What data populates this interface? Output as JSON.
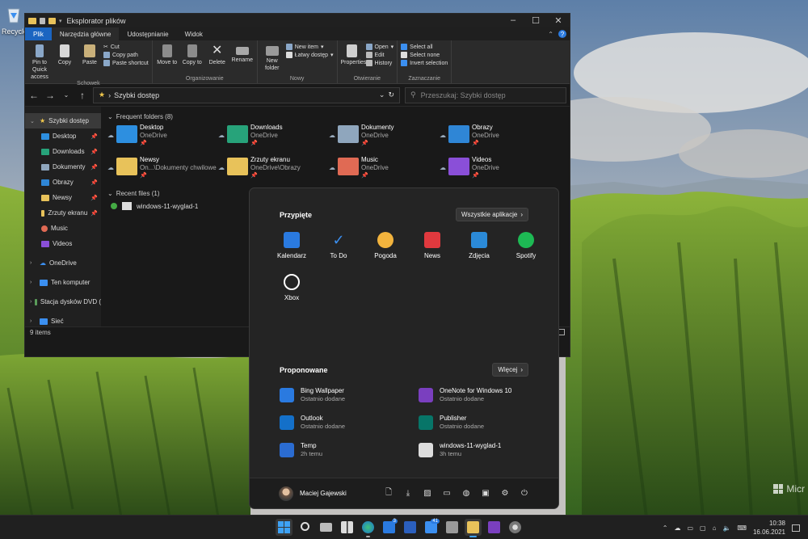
{
  "desktop": {
    "recycle_bin_label": "Recycle"
  },
  "watermark": "Micr",
  "explorer": {
    "title": "Eksplorator plików",
    "window_buttons": [
      "–",
      "☐",
      "✕"
    ],
    "tabs": [
      "Plik",
      "Narzędzia główne",
      "Udostępnianie",
      "Widok"
    ],
    "ribbon": {
      "clipboard": {
        "name": "Schowek",
        "pin": "Pin to Quick access",
        "copy": "Copy",
        "paste": "Paste",
        "cut": "Cut",
        "copy_path": "Copy path",
        "paste_shortcut": "Paste shortcut"
      },
      "organize": {
        "name": "Organizowanie",
        "move_to": "Move to",
        "copy_to": "Copy to",
        "delete": "Delete",
        "rename": "Rename"
      },
      "new": {
        "name": "Nowy",
        "new_folder": "New folder",
        "new_item": "New item",
        "easy_access": "Łatwy dostęp"
      },
      "open": {
        "name": "Otwieranie",
        "properties": "Properties",
        "open": "Open",
        "edit": "Edit",
        "history": "History"
      },
      "select": {
        "name": "Zaznaczanie",
        "select_all": "Select all",
        "select_none": "Select none",
        "invert": "Invert selection"
      }
    },
    "address": "Szybki dostęp",
    "search_placeholder": "Przeszukaj: Szybki dostęp",
    "nav": {
      "quick_access": "Szybki dostęp",
      "items": [
        "Desktop",
        "Downloads",
        "Dokumenty",
        "Obrazy",
        "Newsy",
        "Zrzuty ekranu",
        "Music",
        "Videos"
      ],
      "onedrive": "OneDrive",
      "this_pc": "Ten komputer",
      "dvd": "Stacja dysków DVD (",
      "network": "Sieć"
    },
    "frequent_header": "Frequent folders (8)",
    "folders": [
      {
        "name": "Desktop",
        "loc": "OneDrive",
        "color": "#2d8fe0"
      },
      {
        "name": "Downloads",
        "loc": "OneDrive",
        "color": "#27a37a"
      },
      {
        "name": "Dokumenty",
        "loc": "OneDrive",
        "color": "#8fa6bd"
      },
      {
        "name": "Obrazy",
        "loc": "OneDrive",
        "color": "#2f86d6"
      },
      {
        "name": "Newsy",
        "loc": "On...\\Dokumenty chwilowe",
        "color": "#e8c25a"
      },
      {
        "name": "Zrzuty ekranu",
        "loc": "OneDrive\\Obrazy",
        "color": "#e8c25a"
      },
      {
        "name": "Music",
        "loc": "OneDrive",
        "color": "#e06a54"
      },
      {
        "name": "Videos",
        "loc": "OneDrive",
        "color": "#8a4fd8"
      }
    ],
    "recent_header": "Recent files (1)",
    "recent_file": "windows-11-wyglad-1",
    "status": "9 items"
  },
  "start_menu": {
    "pinned_title": "Przypięte",
    "all_apps": "Wszystkie aplikacje",
    "pinned": [
      {
        "name": "Kalendarz",
        "icon": "calendar-icon",
        "color": "#2a7ae0"
      },
      {
        "name": "To Do",
        "icon": "check-icon",
        "color": "#3b8ff0"
      },
      {
        "name": "Pogoda",
        "icon": "weather-icon",
        "color": "#f2b33d"
      },
      {
        "name": "News",
        "icon": "news-icon",
        "color": "#e0393e"
      },
      {
        "name": "Zdjęcia",
        "icon": "photos-icon",
        "color": "#2b8ad8"
      },
      {
        "name": "Spotify",
        "icon": "spotify-icon",
        "color": "#1db954"
      },
      {
        "name": "Xbox",
        "icon": "xbox-icon",
        "color": "#ffffff"
      }
    ],
    "recommended_title": "Proponowane",
    "more": "Więcej",
    "recommended": [
      {
        "name": "Bing Wallpaper",
        "sub": "Ostatnio dodane",
        "color": "#2a7ae0"
      },
      {
        "name": "OneNote for Windows 10",
        "sub": "Ostatnio dodane",
        "color": "#7a3fbf"
      },
      {
        "name": "Outlook",
        "sub": "Ostatnio dodane",
        "color": "#1470c9"
      },
      {
        "name": "Publisher",
        "sub": "Ostatnio dodane",
        "color": "#077568"
      },
      {
        "name": "Temp",
        "sub": "2h temu",
        "color": "#2b6cd1"
      },
      {
        "name": "windows-11-wyglad-1",
        "sub": "3h temu",
        "color": "#dddddd"
      }
    ],
    "user": "Maciej Gajewski"
  },
  "taskbar": {
    "time": "10:38",
    "date": "16.06.2021",
    "mail_badge": "3",
    "teams_badge": "41"
  }
}
